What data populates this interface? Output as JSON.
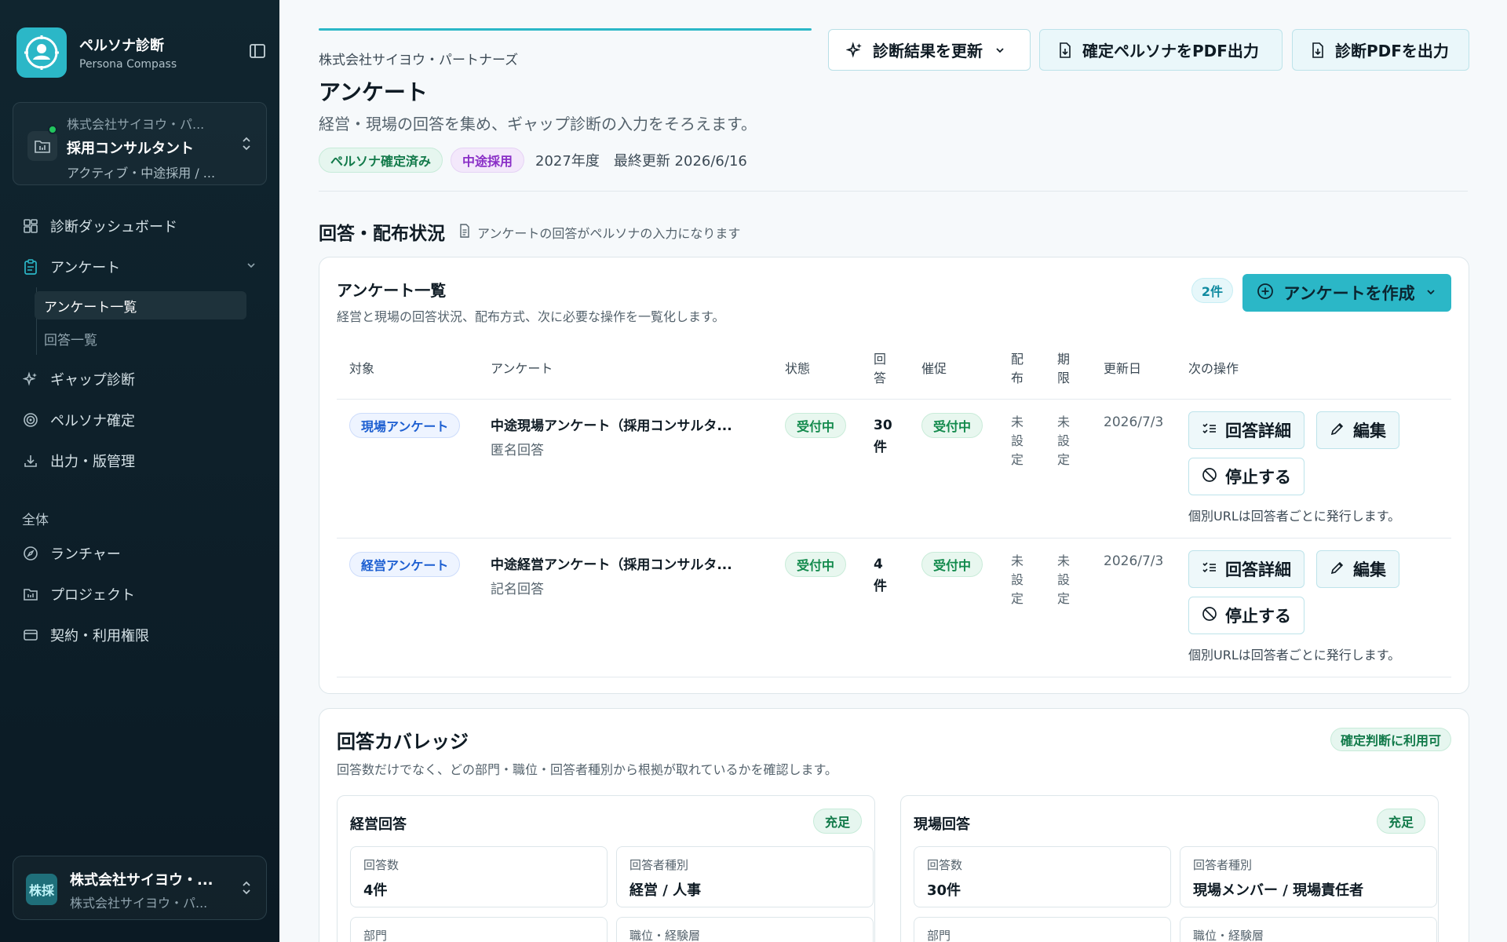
{
  "sidebar": {
    "brand_name": "ペルソナ診断",
    "brand_sub": "Persona Compass",
    "project": {
      "company": "株式会社サイヨウ・パ...",
      "role": "採用コンサルタント",
      "status": "アクティブ・中途採用 / ..."
    },
    "nav": {
      "dashboard": "診断ダッシュボード",
      "survey": "アンケート",
      "survey_list": "アンケート一覧",
      "answer_list": "回答一覧",
      "gap": "ギャップ診断",
      "persona": "ペルソナ確定",
      "export": "出力・版管理"
    },
    "section_all": "全体",
    "global_nav": {
      "launcher": "ランチャー",
      "project": "プロジェクト",
      "contract": "契約・利用権限"
    },
    "user": {
      "avatar": "株採",
      "name": "株式会社サイヨウ・...",
      "sub": "株式会社サイヨウ・パ..."
    }
  },
  "header": {
    "company": "株式会社サイヨウ・パートナーズ",
    "title": "アンケート",
    "description": "経営・現場の回答を集め、ギャップ診断の入力をそろえます。",
    "tag_confirmed": "ペルソナ確定済み",
    "tag_midcareer": "中途採用",
    "meta": "2027年度　最終更新 2026/6/16",
    "btn_refresh": "診断結果を更新",
    "btn_export_persona": "確定ペルソナをPDF出力",
    "btn_export_diag": "診断PDFを出力"
  },
  "status_section": {
    "title": "回答・配布状況",
    "hint": "アンケートの回答がペルソナの入力になります"
  },
  "survey_card": {
    "title": "アンケート一覧",
    "description": "経営と現場の回答状況、配布方式、次に必要な操作を一覧化します。",
    "count": "2件",
    "create_label": "アンケートを作成",
    "columns": {
      "target": "対象",
      "survey": "アンケート",
      "state": "状態",
      "answers": "回答",
      "remind": "催促",
      "dist": "配布",
      "deadline": "期限",
      "updated": "更新日",
      "next": "次の操作"
    },
    "rows": [
      {
        "target": "現場アンケート",
        "name": "中途現場アンケート（採用コンサルタ...",
        "mode": "匿名回答",
        "state": "受付中",
        "answers_num": "30",
        "answers_unit": "件",
        "remind": "受付中",
        "dist": "未設定",
        "deadline": "未設定",
        "updated": "2026/7/3",
        "btn_detail": "回答詳細",
        "btn_edit": "編集",
        "btn_stop": "停止する",
        "note": "個別URLは回答者ごとに発行します。"
      },
      {
        "target": "経営アンケート",
        "name": "中途経営アンケート（採用コンサルタ...",
        "mode": "記名回答",
        "state": "受付中",
        "answers_num": "4",
        "answers_unit": "件",
        "remind": "受付中",
        "dist": "未設定",
        "deadline": "未設定",
        "updated": "2026/7/3",
        "btn_detail": "回答詳細",
        "btn_edit": "編集",
        "btn_stop": "停止する",
        "note": "個別URLは回答者ごとに発行します。"
      }
    ]
  },
  "coverage": {
    "title": "回答カバレッジ",
    "description": "回答数だけでなく、どの部門・職位・回答者種別から根拠が取れているかを確認します。",
    "badge": "確定判断に利用可",
    "panels": [
      {
        "title": "経営回答",
        "badge": "充足",
        "count_label": "回答数",
        "count_value": "4件",
        "type_label": "回答者種別",
        "type_value": "経営 / 人事",
        "dept_label": "部門",
        "level_label": "職位・経験層"
      },
      {
        "title": "現場回答",
        "badge": "充足",
        "count_label": "回答数",
        "count_value": "30件",
        "type_label": "回答者種別",
        "type_value": "現場メンバー / 現場責任者",
        "dept_label": "部門",
        "level_label": "職位・経験層"
      }
    ]
  },
  "colors": {
    "accent": "#2bb7c7",
    "sidebar_bg": "#0f2530",
    "success": "#127a4a"
  }
}
